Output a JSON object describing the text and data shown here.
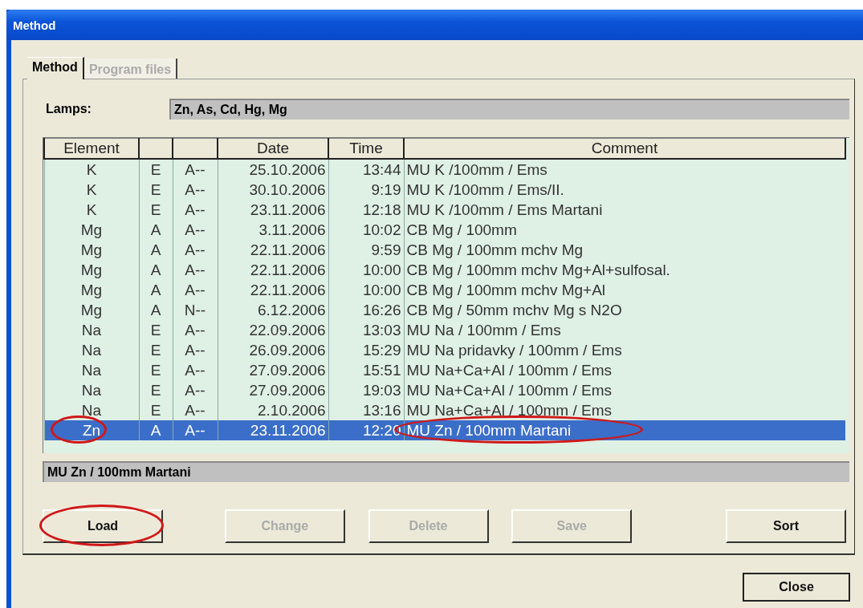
{
  "window": {
    "title": "Method"
  },
  "tabs": [
    {
      "label": "Method",
      "selected": true,
      "disabled": false
    },
    {
      "label": "Program files",
      "selected": false,
      "disabled": true
    }
  ],
  "lamps": {
    "label": "Lamps:",
    "value": "Zn, As, Cd, Hg, Mg"
  },
  "table": {
    "columns": [
      "Element",
      "",
      "",
      "Date",
      "Time",
      "Comment"
    ],
    "rows": [
      {
        "cells": [
          "K",
          "E",
          "A--",
          "25.10.2006",
          "13:44",
          "MU K /100mm / Ems"
        ],
        "selected": false
      },
      {
        "cells": [
          "K",
          "E",
          "A--",
          "30.10.2006",
          "9:19",
          "MU K /100mm / Ems/II."
        ],
        "selected": false
      },
      {
        "cells": [
          "K",
          "E",
          "A--",
          "23.11.2006",
          "12:18",
          "MU K /100mm / Ems Martani"
        ],
        "selected": false
      },
      {
        "cells": [
          "Mg",
          "A",
          "A--",
          "3.11.2006",
          "10:02",
          "CB Mg / 100mm"
        ],
        "selected": false
      },
      {
        "cells": [
          "Mg",
          "A",
          "A--",
          "22.11.2006",
          "9:59",
          "CB Mg / 100mm mchv Mg"
        ],
        "selected": false
      },
      {
        "cells": [
          "Mg",
          "A",
          "A--",
          "22.11.2006",
          "10:00",
          "CB Mg / 100mm mchv Mg+Al+sulfosal."
        ],
        "selected": false
      },
      {
        "cells": [
          "Mg",
          "A",
          "A--",
          "22.11.2006",
          "10:00",
          "CB Mg / 100mm mchv Mg+Al"
        ],
        "selected": false
      },
      {
        "cells": [
          "Mg",
          "A",
          "N--",
          "6.12.2006",
          "16:26",
          "CB Mg / 50mm mchv Mg s N2O"
        ],
        "selected": false
      },
      {
        "cells": [
          "Na",
          "E",
          "A--",
          "22.09.2006",
          "13:03",
          "MU Na / 100mm / Ems"
        ],
        "selected": false
      },
      {
        "cells": [
          "Na",
          "E",
          "A--",
          "26.09.2006",
          "15:29",
          "MU Na pridavky / 100mm / Ems"
        ],
        "selected": false
      },
      {
        "cells": [
          "Na",
          "E",
          "A--",
          "27.09.2006",
          "15:51",
          "MU Na+Ca+Al / 100mm / Ems"
        ],
        "selected": false
      },
      {
        "cells": [
          "Na",
          "E",
          "A--",
          "27.09.2006",
          "19:03",
          "MU Na+Ca+Al / 100mm / Ems"
        ],
        "selected": false
      },
      {
        "cells": [
          "Na",
          "E",
          "A--",
          "2.10.2006",
          "13:16",
          "MU Na+Ca+Al / 100mm / Ems"
        ],
        "selected": false
      },
      {
        "cells": [
          "Zn",
          "A",
          "A--",
          "23.11.2006",
          "12:20",
          "MU Zn / 100mm Martani"
        ],
        "selected": true
      }
    ]
  },
  "comment_field": {
    "value": "MU Zn / 100mm Martani"
  },
  "buttons": [
    {
      "label": "Load",
      "disabled": false,
      "circled": true
    },
    {
      "label": "Change",
      "disabled": true,
      "circled": false
    },
    {
      "label": "Delete",
      "disabled": true,
      "circled": false
    },
    {
      "label": "Save",
      "disabled": true,
      "circled": false
    },
    {
      "label": "Sort",
      "disabled": false,
      "circled": false
    }
  ],
  "close_button": {
    "label": "Close"
  }
}
